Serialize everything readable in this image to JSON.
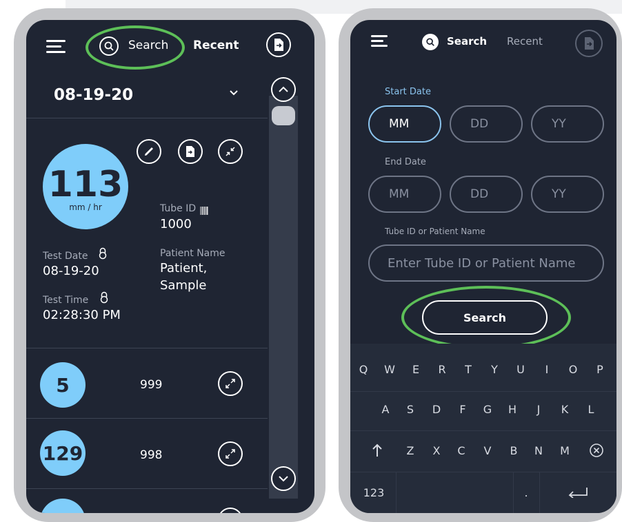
{
  "left_screen": {
    "header": {
      "search_label": "Search",
      "recent_label": "Recent"
    },
    "date_selector": {
      "value": "08-19-20"
    },
    "result": {
      "value": "113",
      "unit": "mm / hr",
      "tube_id_label": "Tube ID",
      "tube_id_value": "1000",
      "test_date_label": "Test Date",
      "test_date_value": "08-19-20",
      "test_time_label": "Test Time",
      "test_time_value": "02:28:30 PM",
      "patient_name_label": "Patient Name",
      "patient_name_line1": "Patient,",
      "patient_name_line2": "Sample"
    },
    "list": [
      {
        "value": "5",
        "tube_id": "999"
      },
      {
        "value": "129",
        "tube_id": "998"
      }
    ],
    "colors": {
      "badge": "#7fcdfa",
      "highlight": "#5dbf58",
      "background": "#1f2533"
    }
  },
  "right_screen": {
    "header": {
      "search_label": "Search",
      "recent_label": "Recent"
    },
    "start_date_label": "Start Date",
    "end_date_label": "End Date",
    "date_placeholders": {
      "month": "MM",
      "day": "DD",
      "year": "YY"
    },
    "tube_patient_label": "Tube ID or Patient Name",
    "tube_patient_placeholder": "Enter Tube ID or Patient Name",
    "search_button": "Search",
    "keyboard": {
      "row1": [
        "Q",
        "W",
        "E",
        "R",
        "T",
        "Y",
        "U",
        "I",
        "O",
        "P"
      ],
      "row2": [
        "A",
        "S",
        "D",
        "F",
        "G",
        "H",
        "J",
        "K",
        "L"
      ],
      "row3": [
        "Z",
        "X",
        "C",
        "V",
        "B",
        "N",
        "M"
      ],
      "numbers_key": "123",
      "period_key": "."
    }
  }
}
